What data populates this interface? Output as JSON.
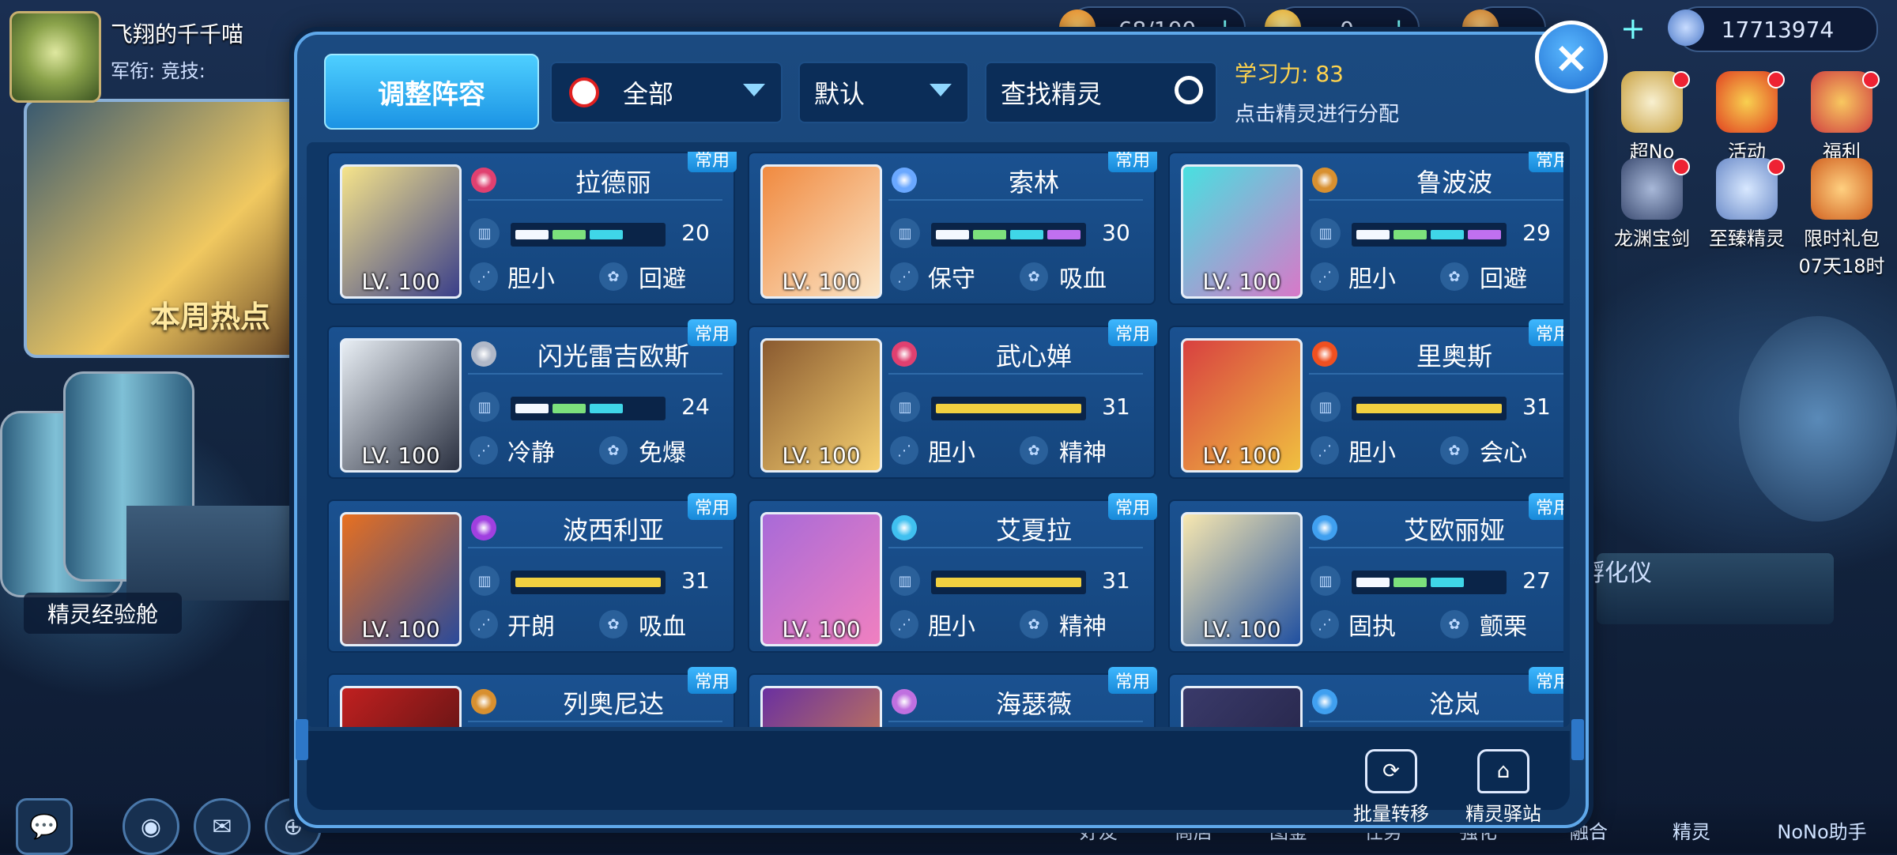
{
  "player": {
    "name": "飞翔的千千喵",
    "meta": "军衔:  竞技:"
  },
  "resources": [
    {
      "value": "68/100",
      "icon": "energy-icon",
      "color": "#f0a020"
    },
    {
      "value": "0",
      "icon": "coin-icon",
      "color": "#f2c230"
    },
    {
      "value": "",
      "icon": "gem-icon",
      "color": "#e0a040"
    },
    {
      "value": "17713974",
      "icon": "planet-icon",
      "color": "#8ab4e8"
    }
  ],
  "right_menu": [
    "超No",
    "活动",
    "福利",
    "龙渊宝剑",
    "至臻精灵",
    "限时礼包"
  ],
  "right_menu_timer": "07天18时",
  "scene_labels": {
    "hot": "本周热点",
    "exp": "精灵经验舱",
    "hatch": "孵化仪"
  },
  "bottom_nav": [
    "好友",
    "商店",
    "图鉴",
    "任务",
    "强化",
    "融合",
    "精灵",
    "NoNo助手"
  ],
  "panel": {
    "adjust_button": "调整阵容",
    "filter_all": "全部",
    "sort_default": "默认",
    "search_placeholder": "查找精灵",
    "learn_label": "学习力:",
    "learn_value": "83",
    "learn_hint": "点击精灵进行分配",
    "footer": {
      "transfer": "批量转移",
      "station": "精灵驿站"
    },
    "close": "×"
  },
  "cards": [
    {
      "name": "拉德丽",
      "level": "LV. 100",
      "tag": "常用",
      "value": "20",
      "bar": "multi",
      "trait1": "胆小",
      "trait2": "回避",
      "attr_color": "#e04070",
      "portrait": [
        "#f6e48a",
        "#3a3f8a"
      ]
    },
    {
      "name": "索林",
      "level": "LV. 100",
      "tag": "常用",
      "value": "30",
      "bar": "multi",
      "trait1": "保守",
      "trait2": "吸血",
      "attr_color": "#6aa8ff",
      "portrait": [
        "#f08a40",
        "#fbe6c8"
      ]
    },
    {
      "name": "鲁波波",
      "level": "LV. 100",
      "tag": "常用",
      "value": "29",
      "bar": "multi",
      "trait1": "胆小",
      "trait2": "回避",
      "attr_color": "#d89030",
      "portrait": [
        "#48e0e0",
        "#d878c8"
      ]
    },
    {
      "name": "闪光雷吉欧斯",
      "level": "LV. 100",
      "tag": "常用",
      "value": "24",
      "bar": "multi",
      "trait1": "冷静",
      "trait2": "免爆",
      "attr_color": "#b0b8c8",
      "portrait": [
        "#e8eef4",
        "#2a3040"
      ]
    },
    {
      "name": "武心婵",
      "level": "LV. 100",
      "tag": "常用",
      "value": "31",
      "bar": "gold",
      "trait1": "胆小",
      "trait2": "精神",
      "attr_color": "#e04070",
      "portrait": [
        "#8a5a30",
        "#f6d070"
      ]
    },
    {
      "name": "里奥斯",
      "level": "LV. 100",
      "tag": "常用",
      "value": "31",
      "bar": "gold",
      "trait1": "胆小",
      "trait2": "会心",
      "attr_color": "#f05020",
      "portrait": [
        "#d84040",
        "#f0c040"
      ]
    },
    {
      "name": "波西利亚",
      "level": "LV. 100",
      "tag": "常用",
      "value": "31",
      "bar": "gold",
      "trait1": "开朗",
      "trait2": "吸血",
      "attr_color": "#a040e0",
      "portrait": [
        "#e87020",
        "#2a4a9a"
      ]
    },
    {
      "name": "艾夏拉",
      "level": "LV. 100",
      "tag": "常用",
      "value": "31",
      "bar": "gold",
      "trait1": "胆小",
      "trait2": "精神",
      "attr_color": "#40c0f0",
      "portrait": [
        "#a86ad8",
        "#f080c0"
      ]
    },
    {
      "name": "艾欧丽娅",
      "level": "LV. 100",
      "tag": "常用",
      "value": "27",
      "bar": "multi",
      "trait1": "固执",
      "trait2": "颤栗",
      "attr_color": "#40a0f0",
      "portrait": [
        "#f8e8b0",
        "#2050a0"
      ]
    },
    {
      "name": "列奥尼达",
      "level": "",
      "tag": "常用",
      "value": "",
      "bar": "none",
      "trait1": "",
      "trait2": "",
      "attr_color": "#d89030",
      "portrait": [
        "#c02020",
        "#401010"
      ]
    },
    {
      "name": "海瑟薇",
      "level": "",
      "tag": "常用",
      "value": "",
      "bar": "none",
      "trait1": "",
      "trait2": "",
      "attr_color": "#c070e0",
      "portrait": [
        "#6a30a0",
        "#e09040"
      ]
    },
    {
      "name": "沧岚",
      "level": "",
      "tag": "常用",
      "value": "",
      "bar": "none",
      "trait1": "",
      "trait2": "",
      "attr_color": "#40a0f0",
      "portrait": [
        "#3a3a6a",
        "#202040"
      ]
    }
  ],
  "colors": {
    "gold_bar": "#f2d040",
    "seg_white": "#f4f8ff",
    "seg_green": "#7ce07c",
    "seg_cyan": "#3fd6e8",
    "seg_purple": "#c070f0"
  }
}
